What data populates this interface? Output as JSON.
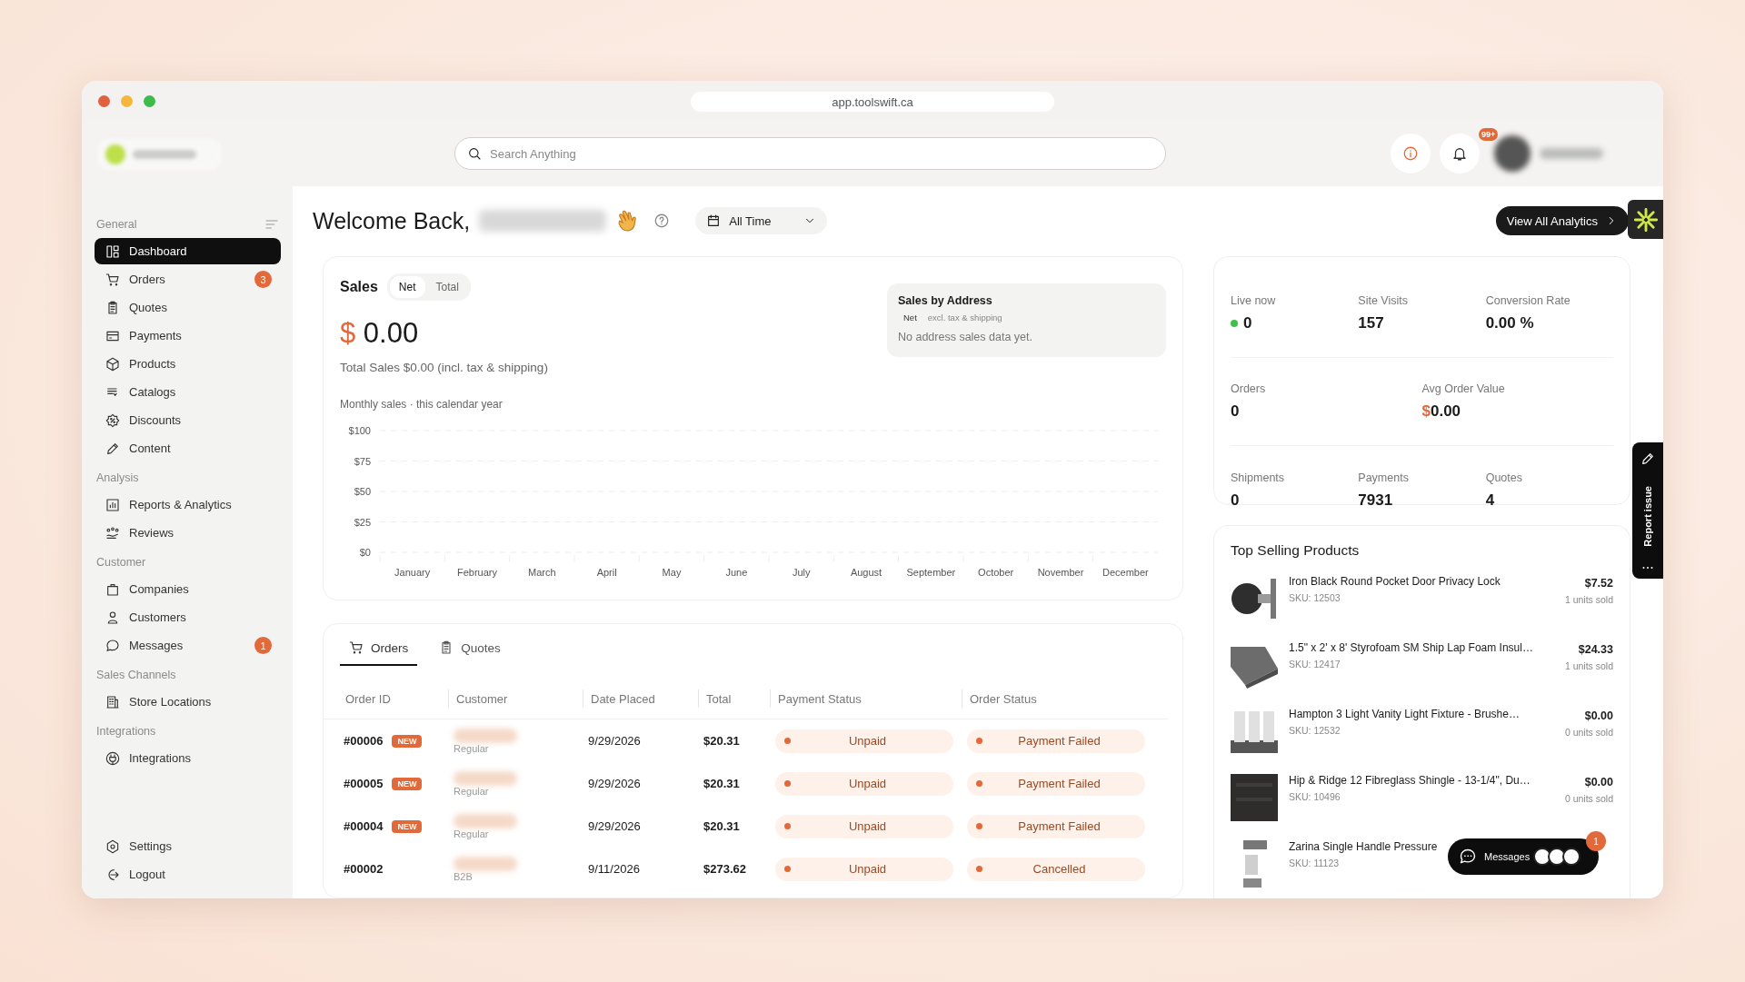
{
  "browser": {
    "url": "app.toolswift.ca"
  },
  "header": {
    "search": {
      "placeholder": "Search Anything"
    },
    "notifications_badge": "99+"
  },
  "sidebar": {
    "sections": [
      {
        "title": "General",
        "items": [
          {
            "label": "Dashboard",
            "selected": true
          },
          {
            "label": "Orders",
            "badge": "3",
            "selected": false
          },
          {
            "label": "Quotes",
            "selected": false
          },
          {
            "label": "Payments",
            "selected": false
          },
          {
            "label": "Products",
            "selected": false
          },
          {
            "label": "Catalogs",
            "selected": false
          },
          {
            "label": "Discounts",
            "selected": false
          },
          {
            "label": "Content",
            "selected": false
          }
        ]
      },
      {
        "title": "Analysis",
        "items": [
          {
            "label": "Reports & Analytics",
            "selected": false
          },
          {
            "label": "Reviews",
            "selected": false
          }
        ]
      },
      {
        "title": "Customer",
        "items": [
          {
            "label": "Companies",
            "selected": false
          },
          {
            "label": "Customers",
            "selected": false
          },
          {
            "label": "Messages",
            "badge": "1",
            "selected": false
          }
        ]
      },
      {
        "title": "Sales Channels",
        "items": [
          {
            "label": "Store Locations",
            "selected": false
          }
        ]
      },
      {
        "title": "Integrations",
        "items": [
          {
            "label": "Integrations",
            "selected": false
          }
        ]
      }
    ],
    "footer_items": [
      {
        "label": "Settings"
      },
      {
        "label": "Logout"
      }
    ]
  },
  "welcome": {
    "greeting": "Welcome Back,",
    "period": "All Time"
  },
  "analytics_button": "View All Analytics",
  "sales": {
    "title": "Sales",
    "modes": [
      {
        "label": "Net",
        "selected": true
      },
      {
        "label": "Total",
        "selected": false
      }
    ],
    "currency": "$",
    "amount": "0.00",
    "total_line": "Total Sales $0.00 (incl. tax & shipping)",
    "chart_caption": "Monthly sales · this calendar year",
    "chart_data": {
      "type": "line",
      "categories": [
        "January",
        "February",
        "March",
        "April",
        "May",
        "June",
        "July",
        "August",
        "September",
        "October",
        "November",
        "December"
      ],
      "grid": true,
      "ylim": [
        0,
        100
      ],
      "yticks": [
        {
          "value": 0,
          "label": "$0"
        },
        {
          "value": 25,
          "label": "$25"
        },
        {
          "value": 50,
          "label": "$50"
        },
        {
          "value": 75,
          "label": "$75"
        },
        {
          "value": 100,
          "label": "$100"
        }
      ]
    },
    "by_address": {
      "title": "Sales by Address",
      "tag": "Net",
      "note": "excl. tax & shipping",
      "empty": "No address sales data yet."
    }
  },
  "stats": [
    [
      {
        "label": "Live now",
        "value": "0",
        "live": true
      },
      {
        "label": "Site Visits",
        "value": "157"
      },
      {
        "label": "Conversion Rate",
        "value": "0.00 %"
      }
    ],
    [
      {
        "label": "Orders",
        "value": "0"
      },
      {
        "label": "Avg Order Value",
        "currency": "$",
        "value": "0.00"
      }
    ],
    [
      {
        "label": "Shipments",
        "value": "0"
      },
      {
        "label": "Payments",
        "value": "7931"
      },
      {
        "label": "Quotes",
        "value": "4"
      }
    ]
  ],
  "orders_panel": {
    "tabs": [
      {
        "label": "Orders",
        "selected": true
      },
      {
        "label": "Quotes",
        "selected": false
      }
    ],
    "columns": [
      "Order ID",
      "Customer",
      "Date Placed",
      "Total",
      "Payment Status",
      "Order Status"
    ],
    "rows": [
      {
        "order_id": "#00006",
        "badge": "NEW",
        "customer_type": "Regular",
        "date": "9/29/2026",
        "total": "$20.31",
        "payment_status": "Unpaid",
        "order_status": "Payment Failed"
      },
      {
        "order_id": "#00005",
        "badge": "NEW",
        "customer_type": "Regular",
        "date": "9/29/2026",
        "total": "$20.31",
        "payment_status": "Unpaid",
        "order_status": "Payment Failed"
      },
      {
        "order_id": "#00004",
        "badge": "NEW",
        "customer_type": "Regular",
        "date": "9/29/2026",
        "total": "$20.31",
        "payment_status": "Unpaid",
        "order_status": "Payment Failed"
      },
      {
        "order_id": "#00002",
        "customer_type": "B2B",
        "date": "9/11/2026",
        "total": "$273.62",
        "payment_status": "Unpaid",
        "order_status": "Cancelled"
      }
    ]
  },
  "top_products": {
    "title": "Top Selling Products",
    "items": [
      {
        "name": "Iron Black Round Pocket Door Privacy Lock",
        "sku": "SKU: 12503",
        "price": "$7.52",
        "sold": "1 units sold"
      },
      {
        "name": "1.5\" x 2' x 8' Styrofoam SM Ship Lap Foam Insul…",
        "sku": "SKU: 12417",
        "price": "$24.33",
        "sold": "1 units sold"
      },
      {
        "name": "Hampton 3 Light Vanity Light Fixture - Brushe…",
        "sku": "SKU: 12532",
        "price": "$0.00",
        "sold": "0 units sold"
      },
      {
        "name": "Hip & Ridge 12 Fibreglass Shingle - 13-1/4\", Du…",
        "sku": "SKU: 10496",
        "price": "$0.00",
        "sold": "0 units sold"
      },
      {
        "name": "Zarina Single Handle Pressure",
        "sku": "SKU: 11123"
      }
    ]
  },
  "messages_button": {
    "label": "Messages",
    "badge": "1"
  },
  "report_tab": {
    "label": "Report issue"
  }
}
